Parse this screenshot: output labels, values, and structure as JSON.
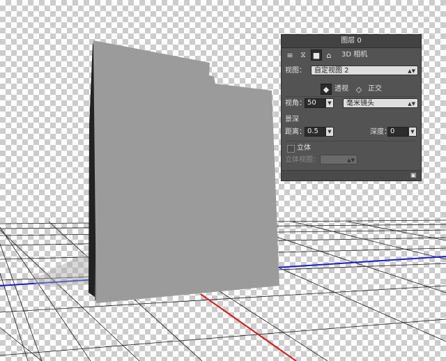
{
  "panel": {
    "title": "图层 0",
    "toolbar": {
      "section_label": "3D 相机",
      "icons": [
        "scene-icon",
        "mesh-icon",
        "camera-icon",
        "lights-icon"
      ]
    },
    "view": {
      "label": "视图：",
      "value": "自定视图 2"
    },
    "projection": {
      "perspective_label": "透视",
      "ortho_label": "正交"
    },
    "fov": {
      "label": "视角：",
      "value": "50",
      "unit_value": "毫米镜头"
    },
    "dof": {
      "section_label": "景深",
      "distance_label": "距离：",
      "distance_value": "0.5",
      "depth_label": "深度：",
      "depth_value": "0"
    },
    "stereo": {
      "label": "立体",
      "view_label": "立体视图：",
      "view_value": ""
    }
  },
  "colors": {
    "panel_bg": "#535353",
    "x_axis": "#d42020",
    "z_axis": "#1a1ad0",
    "object": "#9b9b9b"
  }
}
